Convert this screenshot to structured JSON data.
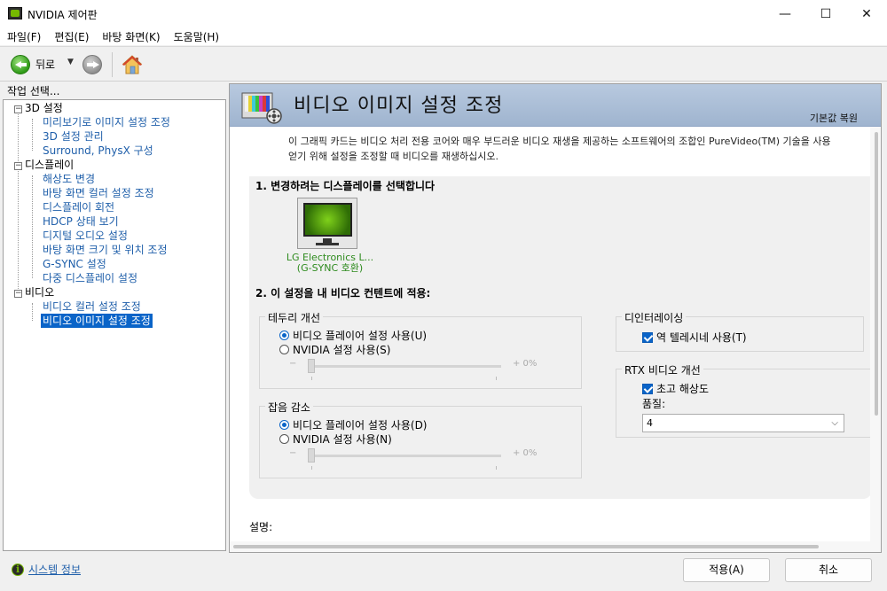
{
  "window": {
    "title": "NVIDIA 제어판",
    "minimize": "—",
    "maximize": "☐",
    "close": "✕"
  },
  "menu": [
    "파일(F)",
    "편집(E)",
    "바탕 화면(K)",
    "도움말(H)"
  ],
  "toolbar": {
    "back_label": "뒤로",
    "dropdown_glyph": "▼"
  },
  "left": {
    "header": "작업 선택...",
    "tree": [
      {
        "category": "3D 설정",
        "items": [
          "미리보기로 이미지 설정 조정",
          "3D 설정 관리",
          "Surround, PhysX 구성"
        ]
      },
      {
        "category": "디스플레이",
        "items": [
          "해상도 변경",
          "바탕 화면 컬러 설정 조정",
          "디스플레이 회전",
          "HDCP 상태 보기",
          "디지털 오디오 설정",
          "바탕 화면 크기 및 위치 조정",
          "G-SYNC 설정",
          "다중 디스플레이 설정"
        ]
      },
      {
        "category": "비디오",
        "items": [
          "비디오 컬러 설정 조정",
          "비디오 이미지 설정 조정"
        ]
      }
    ],
    "collapse_glyph": "−",
    "selected_item": "비디오 이미지 설정 조정",
    "system_info": "시스템 정보"
  },
  "main": {
    "title": "비디오 이미지 설정 조정",
    "restore_defaults": "기본값 복원",
    "intro_line1": "이 그래픽 카드는 비디오 처리 전용 코어와 매우 부드러운 비디오 재생을 제공하는 소프트웨어의 조합인 PureVideo(TM) 기술을 사용",
    "intro_line2": "얻기 위해 설정을 조정할 때 비디오를 재생하십시오.",
    "section1": "1. 변경하려는 디스플레이를 선택합니다",
    "display_name": "LG Electronics L...",
    "display_sub": "(G-SYNC 호환)",
    "section2": "2. 이 설정을 내 비디오 컨텐트에 적용:",
    "edge": {
      "title": "테두리 개선",
      "option1": "비디오 플레이어 설정 사용(U)",
      "option2": "NVIDIA 설정 사용(S)",
      "selected": 1,
      "minus": "−",
      "plus_value": "+  0%",
      "value_percent": 0
    },
    "noise": {
      "title": "잡음 감소",
      "option1": "비디오 플레이어 설정 사용(D)",
      "option2": "NVIDIA 설정 사용(N)",
      "selected": 1,
      "minus": "−",
      "plus_value": "+  0%",
      "value_percent": 0
    },
    "deinterlace": {
      "title": "디인터레이싱",
      "checkbox_label": "역 텔레시네 사용(T)",
      "checked": true
    },
    "rtx": {
      "title": "RTX 비디오 개선",
      "checkbox_label": "초고 해상도",
      "checked": true,
      "quality_label": "품질:",
      "quality_value": "4",
      "chevron": "⌵"
    },
    "description_label": "설명:"
  },
  "buttons": {
    "apply": "적용(A)",
    "cancel": "취소"
  },
  "colors": {
    "link": "#1f5faa",
    "selection": "#0a64c8",
    "nvidia_green": "#76b900",
    "display_label": "#2e8b1e",
    "banner": "#a9bcd6"
  }
}
